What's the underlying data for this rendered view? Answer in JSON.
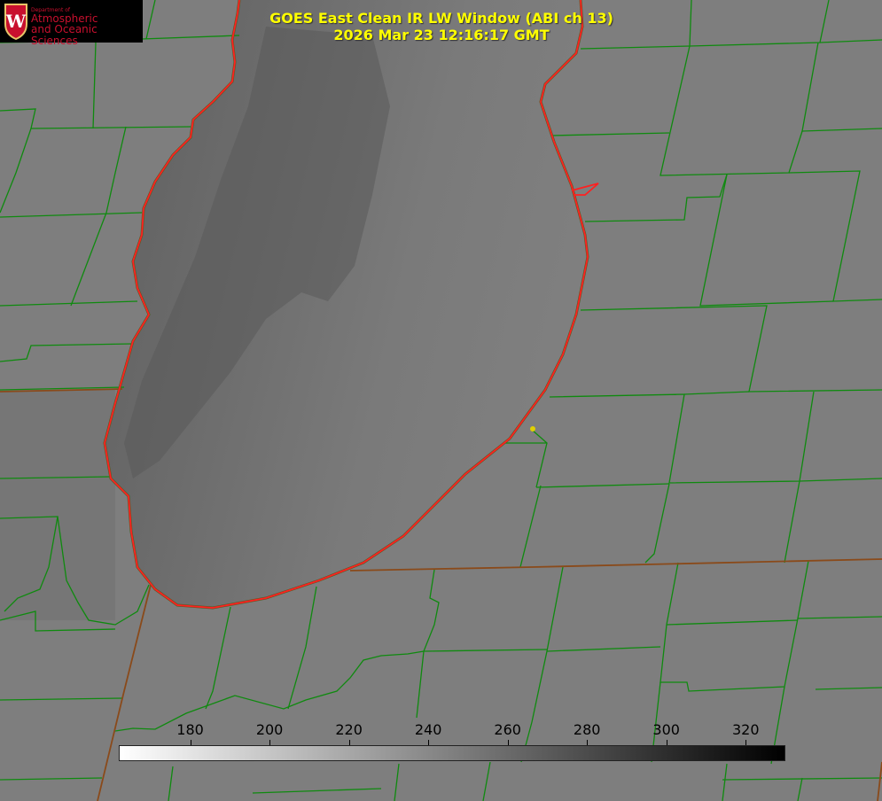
{
  "header": {
    "line1": "GOES East Clean IR LW Window (ABI ch 13)",
    "line2": "2026 Mar 23 12:16:17 GMT"
  },
  "logo": {
    "department": "Department of",
    "line1": "Atmospheric",
    "line2": "and Oceanic Sciences",
    "shield_letter": "W"
  },
  "colorbar": {
    "ticks": [
      "180",
      "200",
      "220",
      "240",
      "260",
      "280",
      "300",
      "320"
    ],
    "min_value": 162,
    "max_value": 330
  },
  "colors": {
    "title": "#ffff00",
    "county_lines": "#0f8a0f",
    "state_lines": "#8a4a1a",
    "lake_outline": "#ff2020",
    "marker": "#e0d000",
    "land": "#7d7d7d",
    "lake": "#727272"
  },
  "map": {
    "feature": "Lake Michigan (southern basin)",
    "marker_icon": "station-dot-icon"
  }
}
